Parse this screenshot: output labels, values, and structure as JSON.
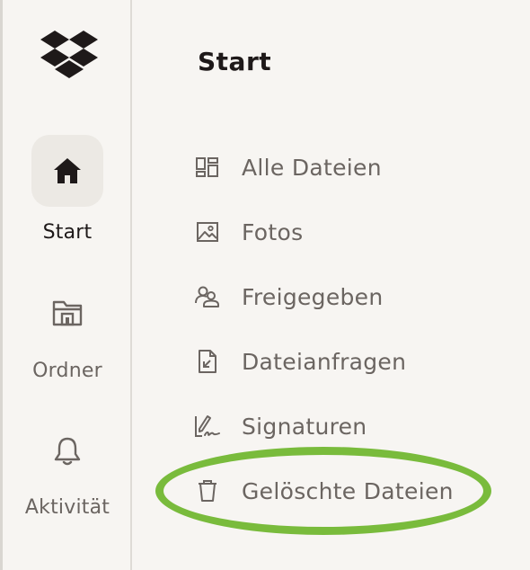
{
  "rail": {
    "items": [
      {
        "label": "Start",
        "icon": "home-icon",
        "active": true
      },
      {
        "label": "Ordner",
        "icon": "folder-icon",
        "active": false
      },
      {
        "label": "Aktivität",
        "icon": "bell-icon",
        "active": false
      }
    ]
  },
  "main": {
    "title": "Start",
    "nav": [
      {
        "label": "Alle Dateien",
        "icon": "all-files-icon"
      },
      {
        "label": "Fotos",
        "icon": "photo-icon"
      },
      {
        "label": "Freigegeben",
        "icon": "shared-icon"
      },
      {
        "label": "Dateianfragen",
        "icon": "file-request-icon"
      },
      {
        "label": "Signaturen",
        "icon": "signature-icon"
      },
      {
        "label": "Gelöschte Dateien",
        "icon": "trash-icon",
        "highlighted": true
      }
    ]
  },
  "colors": {
    "background": "#f7f5f2",
    "active_bg": "#ece9e4",
    "text_primary": "#1e1919",
    "text_secondary": "#6b6561",
    "highlight": "#79bb3c"
  }
}
